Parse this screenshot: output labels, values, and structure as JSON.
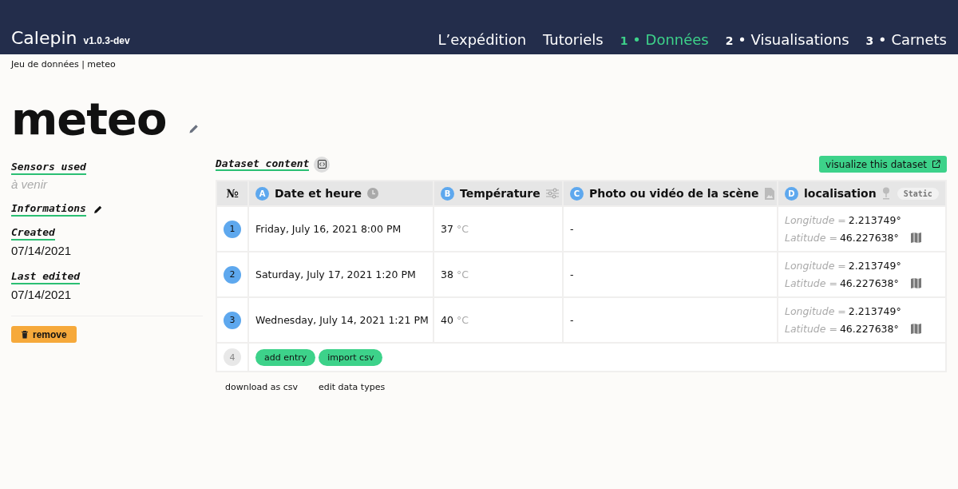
{
  "header": {
    "brand": "Calepin",
    "version": "v1.0.3-dev",
    "nav": [
      {
        "label": "L’expédition",
        "selected": false
      },
      {
        "label": "Tutoriels",
        "selected": false
      },
      {
        "label": "**1** • Données",
        "selected": true
      },
      {
        "label": "**2** • Visualisations",
        "selected": false
      },
      {
        "label": "**3** • Carnets",
        "selected": false
      }
    ]
  },
  "breadcrumb": "Jeu de données | meteo",
  "title": "meteo",
  "sidebar": {
    "sections": [
      {
        "kind": "note",
        "heading": "Sensors used",
        "text": "à venir"
      },
      {
        "kind": "editable",
        "heading": "Informations"
      },
      {
        "kind": "value",
        "heading": "Created",
        "text": "07/14/2021"
      },
      {
        "kind": "value",
        "heading": "Last edited",
        "text": "07/14/2021"
      }
    ],
    "remove_button": "remove"
  },
  "dataset": {
    "heading": "Dataset content",
    "visualize_button": "visualize this dataset",
    "table": {
      "number_column": "№",
      "columns": [
        {
          "badge": "A",
          "label": "Date et heure",
          "kind": "datetime"
        },
        {
          "badge": "B",
          "label": "Température",
          "kind": "number"
        },
        {
          "badge": "C",
          "label": "Photo ou vidéo de la scène",
          "kind": "media"
        },
        {
          "badge": "D",
          "label": "localisation",
          "kind": "location",
          "tag": "Static"
        }
      ],
      "rows": [
        {
          "number": "1",
          "date": "Friday, July 16, 2021 8:00 PM",
          "temperature": "37",
          "unit": "°C",
          "media": "-",
          "longitude_label": "Longitude =",
          "longitude": "2.213749°",
          "latitude_label": "Latitude =",
          "latitude": "46.227638°"
        },
        {
          "number": "2",
          "date": "Saturday, July 17, 2021 1:20 PM",
          "temperature": "38",
          "unit": "°C",
          "media": "-",
          "longitude_label": "Longitude =",
          "longitude": "2.213749°",
          "latitude_label": "Latitude =",
          "latitude": "46.227638°"
        },
        {
          "number": "3",
          "date": "Wednesday, July 14, 2021 1:21 PM",
          "temperature": "40",
          "unit": "°C",
          "media": "-",
          "longitude_label": "Longitude =",
          "longitude": "2.213749°",
          "latitude_label": "Latitude =",
          "latitude": "46.227638°"
        }
      ],
      "new_row": {
        "number": "4",
        "buttons": [
          "add entry",
          "import csv"
        ]
      }
    },
    "links": [
      "download as csv",
      "edit data types"
    ]
  }
}
